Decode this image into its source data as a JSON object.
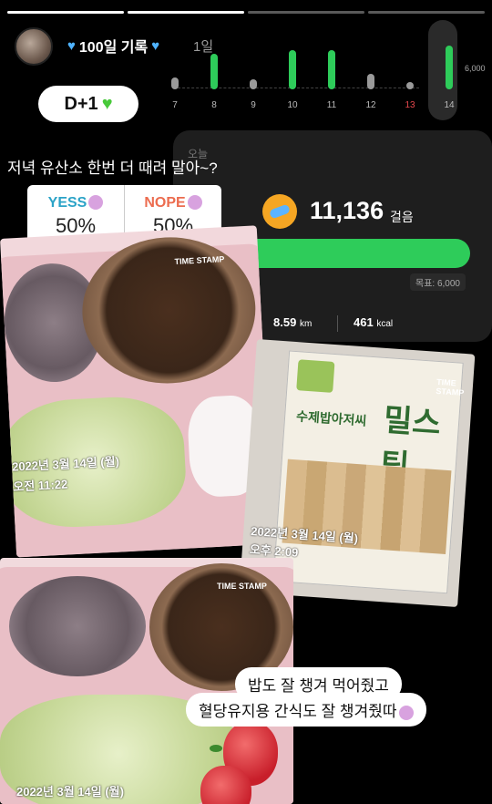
{
  "story": {
    "title": "100일 기록",
    "title_dim": "1일",
    "dday": "D+1",
    "question": "저녁 유산소 한번 더 때려 말아~?"
  },
  "chart_data": {
    "type": "bar",
    "categories": [
      "7",
      "8",
      "9",
      "10",
      "11",
      "12",
      "13",
      "14"
    ],
    "values": [
      3000,
      9000,
      2500,
      10000,
      10000,
      4000,
      1000,
      11136
    ],
    "axis_label": "6,000",
    "highlight_category": "13"
  },
  "health": {
    "today_label": "오늘",
    "steps": "11,136",
    "steps_unit": "걸음",
    "goal": "목표: 6,000",
    "distance": "8.59",
    "distance_unit": "km",
    "kcal": "461",
    "kcal_unit": "kcal"
  },
  "poll": {
    "yes_label": "YESS",
    "yes_pct": "50%",
    "no_label": "NOPE",
    "no_pct": "50%"
  },
  "photos": {
    "stamp_label": "TIME STAMP",
    "p1_date": "2022년 3월 14일 (월)",
    "p1_time": "오전 11:22",
    "p2_date": "2022년 3월 14일 (월)",
    "p2_time": "오후 2:09",
    "p2_pkg_title": "수제밥아저씨",
    "p2_pkg_big": "밀스틱",
    "p3_date": "2022년 3월 14일 (월)"
  },
  "captions": {
    "line1": "밥도 잘 챙겨 먹어줬고",
    "line2": "혈당유지용 간식도 잘 챙겨줬따"
  },
  "colors": {
    "accent_green": "#2ecc5a",
    "heart_blue": "#4fb3ff"
  }
}
